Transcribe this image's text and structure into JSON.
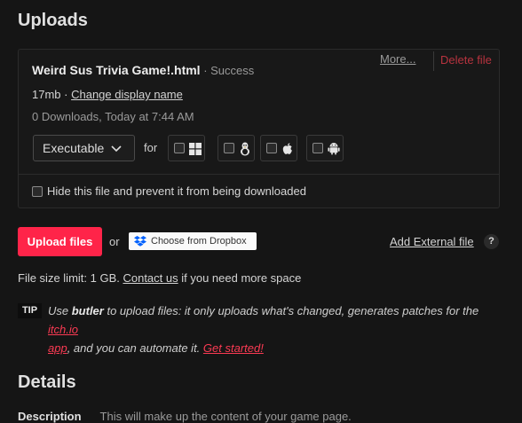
{
  "uploads": {
    "title": "Uploads",
    "file": {
      "name": "Weird Sus Trivia Game!.html",
      "status_sep": " · ",
      "status": "Success",
      "size": "17mb",
      "size_sep": " · ",
      "change_display_name": "Change display name",
      "downloads_info": "0 Downloads, Today at 7:44 AM",
      "more_label": "More...",
      "delete_label": "Delete file",
      "type_select_value": "Executable",
      "for_label": "for",
      "platforms": [
        {
          "name": "windows",
          "icon": "windows-icon"
        },
        {
          "name": "linux",
          "icon": "linux-icon"
        },
        {
          "name": "mac",
          "icon": "apple-icon"
        },
        {
          "name": "android",
          "icon": "android-icon"
        }
      ],
      "hide_label": "Hide this file and prevent it from being downloaded"
    },
    "upload_button": "Upload files",
    "or_label": "or",
    "dropbox_label": "Choose from Dropbox",
    "add_external": "Add External file",
    "help": "?",
    "size_limit_prefix": "File size limit: 1 GB. ",
    "contact_us": "Contact us",
    "size_limit_suffix": " if you need more space",
    "tip": {
      "badge": "TIP",
      "use": "Use ",
      "butler": "butler",
      "text1": " to upload files: it only uploads what's changed, generates patches for the ",
      "itchio": "itch.io",
      "app": "app",
      "text2": ", and you can automate it. ",
      "get_started": "Get started!"
    }
  },
  "details": {
    "title": "Details",
    "description_label": "Description",
    "description_hint": "This will make up the content of your game page."
  },
  "colors": {
    "accent": "#ff2449",
    "background": "#151515",
    "delete": "#b8333f"
  }
}
